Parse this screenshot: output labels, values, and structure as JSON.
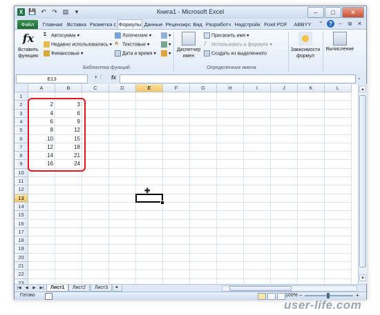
{
  "window": {
    "title": "Книга1 - Microsoft Excel",
    "app_icon": "X",
    "quick_access": [
      "save-icon",
      "undo-icon",
      "redo-icon",
      "print-preview-icon",
      "customize-icon"
    ],
    "controls": {
      "minimize": "–",
      "maximize": "□",
      "close": "✕"
    }
  },
  "ribbon_tabs": {
    "file": "Файл",
    "items": [
      "Главная",
      "Вставка",
      "Разметка с",
      "Формулы",
      "Данные",
      "Рецензирс",
      "Вид",
      "Разработч",
      "Надстройк",
      "Foxit PDF",
      "ABBYY PDF"
    ],
    "active": "Формулы"
  },
  "ribbon": {
    "insert_function": "Вставить функцию",
    "autosum": "Автосумма",
    "recently_used": "Недавно использовались",
    "financial": "Финансовые",
    "logical": "Логические",
    "text": "Текстовые",
    "datetime": "Дата и время",
    "library_label": "Библиотека функций",
    "name_manager": "Диспетчер имен",
    "define_name": "Присвоить имя",
    "use_in_formula": "Использовать в формуле",
    "create_from_selection": "Создать из выделенного",
    "defined_names_label": "Определенные имена",
    "dependencies": "Зависимости формул",
    "calculation": "Вычисление"
  },
  "formula_bar": {
    "name_box": "E13",
    "fx_label": "fx",
    "formula": ""
  },
  "sheet": {
    "columns": [
      "A",
      "B",
      "C",
      "D",
      "E",
      "F",
      "G",
      "H",
      "I",
      "J",
      "K",
      "L"
    ],
    "rows": [
      "1",
      "2",
      "3",
      "4",
      "5",
      "6",
      "7",
      "8",
      "9",
      "10",
      "11",
      "12",
      "13",
      "14",
      "15",
      "16",
      "17",
      "18",
      "19",
      "20",
      "21",
      "22",
      "23"
    ],
    "active_cell": "E13",
    "active_column": "E",
    "active_row": "13",
    "data": [
      {
        "row": "2",
        "a": "2",
        "b": "3"
      },
      {
        "row": "3",
        "a": "4",
        "b": "6"
      },
      {
        "row": "4",
        "a": "6",
        "b": "9"
      },
      {
        "row": "5",
        "a": "8",
        "b": "12"
      },
      {
        "row": "6",
        "a": "10",
        "b": "15"
      },
      {
        "row": "7",
        "a": "12",
        "b": "18"
      },
      {
        "row": "8",
        "a": "14",
        "b": "21"
      },
      {
        "row": "9",
        "a": "16",
        "b": "24"
      }
    ],
    "highlight_color": "#e0141a"
  },
  "sheet_tabs": {
    "tabs": [
      "Лист1",
      "Лист2",
      "Лист3"
    ],
    "active": "Лист1"
  },
  "status_bar": {
    "ready": "Готово",
    "zoom": "100%",
    "zoom_minus": "–",
    "zoom_plus": "+"
  },
  "watermark": "user-life.com"
}
